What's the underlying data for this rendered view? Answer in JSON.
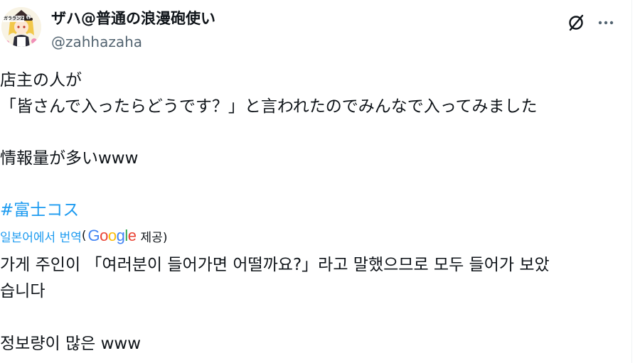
{
  "author": {
    "name": "ザハ@普通の浪漫砲使い",
    "handle": "@zahhazaha",
    "avatar_icon": "avatar-image",
    "avatar_badge_text": "ガラランZ33"
  },
  "toolbar": {
    "grok_icon": "grok-slash-circle-icon",
    "more_icon": "more-horizontal-icon"
  },
  "tweet": {
    "line1": "店主の人が",
    "line2": "「皆さんで入ったらどうです？」と言われたのでみんなで入ってみました",
    "line3": "情報量が多いwww",
    "hashtag": "#富士コス"
  },
  "translation": {
    "link_text": "일본어에서 번역",
    "open_paren": "(",
    "google_letters": [
      "G",
      "o",
      "o",
      "g",
      "l",
      "e"
    ],
    "provided_text": "제공)",
    "line1": "가게 주인이 「여러분이 들어가면 어떨까요?」라고 말했으므로 모두 들어가 보았",
    "line2": "습니다",
    "line3": "정보량이 많은 www"
  },
  "colors": {
    "link": "#1d9bf0",
    "text": "#0f1419",
    "secondary": "#536471"
  }
}
